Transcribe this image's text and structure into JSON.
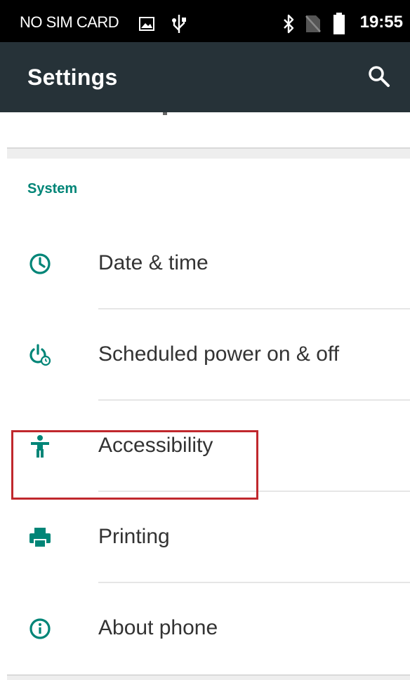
{
  "status_bar": {
    "carrier": "NO SIM CARD",
    "icons": [
      "picture-icon",
      "usb-icon",
      "bluetooth-icon",
      "no-sim-icon",
      "battery-icon"
    ],
    "time": "19:55"
  },
  "app_bar": {
    "title": "Settings",
    "search_icon": "search-icon"
  },
  "section": {
    "header": "System",
    "accent_color": "#008577",
    "items": [
      {
        "label": "Date & time",
        "icon": "clock-icon"
      },
      {
        "label": "Scheduled power on & off",
        "icon": "power-schedule-icon"
      },
      {
        "label": "Accessibility",
        "icon": "accessibility-icon"
      },
      {
        "label": "Printing",
        "icon": "printer-icon"
      },
      {
        "label": "About phone",
        "icon": "info-icon",
        "highlighted": true
      }
    ]
  },
  "colors": {
    "status_bar": "#000000",
    "app_bar": "#263238",
    "highlight_border": "#c0282d"
  }
}
